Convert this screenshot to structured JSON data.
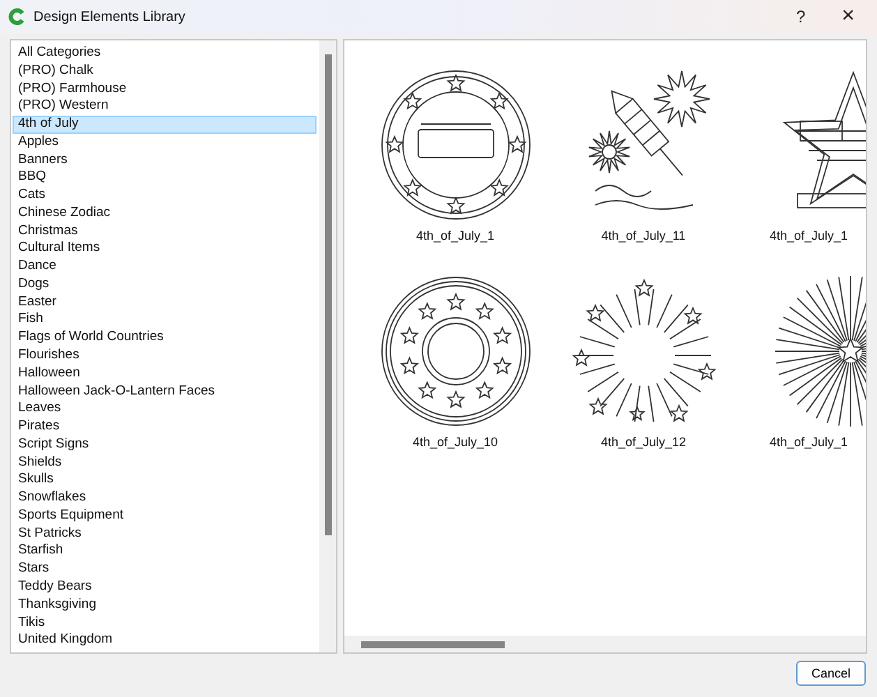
{
  "window": {
    "title": "Design Elements Library",
    "help": "?",
    "close": "×"
  },
  "categories": [
    {
      "label": "All Categories",
      "selected": false
    },
    {
      "label": "(PRO) Chalk",
      "selected": false
    },
    {
      "label": "(PRO) Farmhouse",
      "selected": false
    },
    {
      "label": "(PRO) Western",
      "selected": false
    },
    {
      "label": "4th of July",
      "selected": true
    },
    {
      "label": "Apples",
      "selected": false
    },
    {
      "label": "Banners",
      "selected": false
    },
    {
      "label": "BBQ",
      "selected": false
    },
    {
      "label": "Cats",
      "selected": false
    },
    {
      "label": "Chinese Zodiac",
      "selected": false
    },
    {
      "label": "Christmas",
      "selected": false
    },
    {
      "label": "Cultural Items",
      "selected": false
    },
    {
      "label": "Dance",
      "selected": false
    },
    {
      "label": "Dogs",
      "selected": false
    },
    {
      "label": "Easter",
      "selected": false
    },
    {
      "label": "Fish",
      "selected": false
    },
    {
      "label": "Flags of World Countries",
      "selected": false
    },
    {
      "label": "Flourishes",
      "selected": false
    },
    {
      "label": "Halloween",
      "selected": false
    },
    {
      "label": "Halloween Jack-O-Lantern Faces",
      "selected": false
    },
    {
      "label": "Leaves",
      "selected": false
    },
    {
      "label": "Pirates",
      "selected": false
    },
    {
      "label": "Script Signs",
      "selected": false
    },
    {
      "label": "Shields",
      "selected": false
    },
    {
      "label": "Skulls",
      "selected": false
    },
    {
      "label": "Snowflakes",
      "selected": false
    },
    {
      "label": "Sports Equipment",
      "selected": false
    },
    {
      "label": "St Patricks",
      "selected": false
    },
    {
      "label": "Starfish",
      "selected": false
    },
    {
      "label": "Stars",
      "selected": false
    },
    {
      "label": "Teddy Bears",
      "selected": false
    },
    {
      "label": "Thanksgiving",
      "selected": false
    },
    {
      "label": "Tikis",
      "selected": false
    },
    {
      "label": "United Kingdom",
      "selected": false
    }
  ],
  "designs": [
    {
      "label": "4th_of_July_1",
      "kind": "badge"
    },
    {
      "label": "4th_of_July_11",
      "kind": "rocket"
    },
    {
      "label": "4th_of_July_1",
      "kind": "star-flag"
    },
    {
      "label": "4th_of_July_10",
      "kind": "seal"
    },
    {
      "label": "4th_of_July_12",
      "kind": "fireworks"
    },
    {
      "label": "4th_of_July_1",
      "kind": "starburst"
    }
  ],
  "buttons": {
    "cancel": "Cancel"
  }
}
